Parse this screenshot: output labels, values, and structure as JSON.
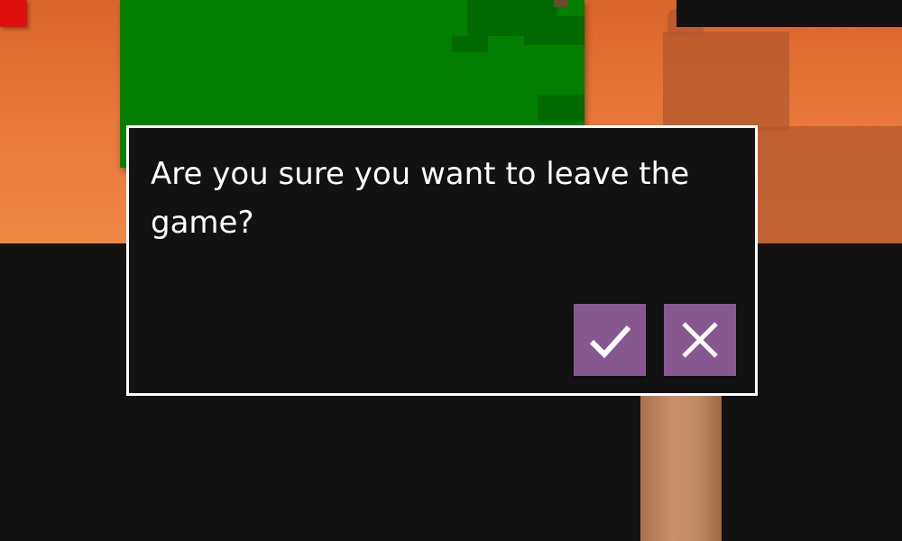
{
  "dialog": {
    "message": "Are you sure you want to leave the game?",
    "confirm_icon": "checkmark-icon",
    "cancel_icon": "close-icon"
  },
  "colors": {
    "sky_top": "#d9652c",
    "sky_bottom": "#f08c47",
    "ground": "#131213",
    "green_block": "#007f00",
    "green_block_shade": "#006a00",
    "red_block": "#e0100e",
    "button": "#86588f",
    "dialog_border": "#ffffff",
    "dialog_text": "#ffffff"
  }
}
